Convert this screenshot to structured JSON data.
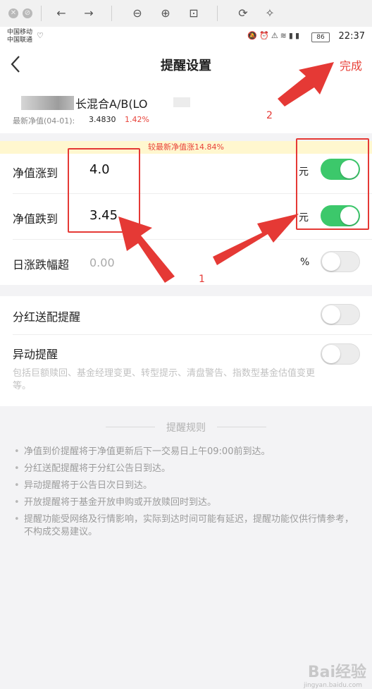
{
  "toolbar": {
    "icons": [
      "close-circle-icon",
      "block-circle-icon",
      "back-arrow-icon",
      "forward-arrow-icon",
      "zoom-out-icon",
      "zoom-in-icon",
      "fit-page-icon",
      "rotate-icon",
      "magic-wand-icon"
    ]
  },
  "status_bar": {
    "carrier1": "中国移动",
    "carrier2": "中国联通",
    "battery": "86",
    "time": "22:37"
  },
  "nav": {
    "back_icon": "chevron-left-icon",
    "title": "提醒设置",
    "done_label": "完成"
  },
  "fund": {
    "name": "长混合A/B(LO",
    "nav_label": "最新净值(04-01):",
    "nav_value": "3.4830",
    "nav_change": "1.42%"
  },
  "banner": {
    "text": "较最新净值涨14.84%"
  },
  "price_alerts": [
    {
      "label": "净值涨到",
      "value": "4.0",
      "unit": "元",
      "enabled": true
    },
    {
      "label": "净值跌到",
      "value": "3.45",
      "unit": "元",
      "enabled": true
    },
    {
      "label": "日涨跌幅超",
      "value": "0.00",
      "unit": "%",
      "enabled": false
    }
  ],
  "other_alerts": [
    {
      "label": "分红送配提醒",
      "enabled": false
    },
    {
      "label": "异动提醒",
      "enabled": false,
      "description": "包括巨额赎回、基金经理变更、转型提示、清盘警告、指数型基金估值变更等。"
    }
  ],
  "rules": {
    "title": "提醒规则",
    "items": [
      "净值到价提醒将于净值更新后下一交易日上午09:00前到达。",
      "分红送配提醒将于分红公告日到达。",
      "异动提醒将于公告日次日到达。",
      "开放提醒将于基金开放申购或开放赎回时到达。",
      "提醒功能受网络及行情影响，实际到达时间可能有延迟，提醒功能仅供行情参考，不构成交易建议。"
    ]
  },
  "annotations": {
    "label1": "1",
    "label2": "2",
    "color": "#e53935"
  },
  "watermark": {
    "brand": "Bai经验",
    "url": "jingyan.baidu.com"
  },
  "colors": {
    "accent_red": "#e8433a",
    "toggle_on": "#3cc86b"
  }
}
